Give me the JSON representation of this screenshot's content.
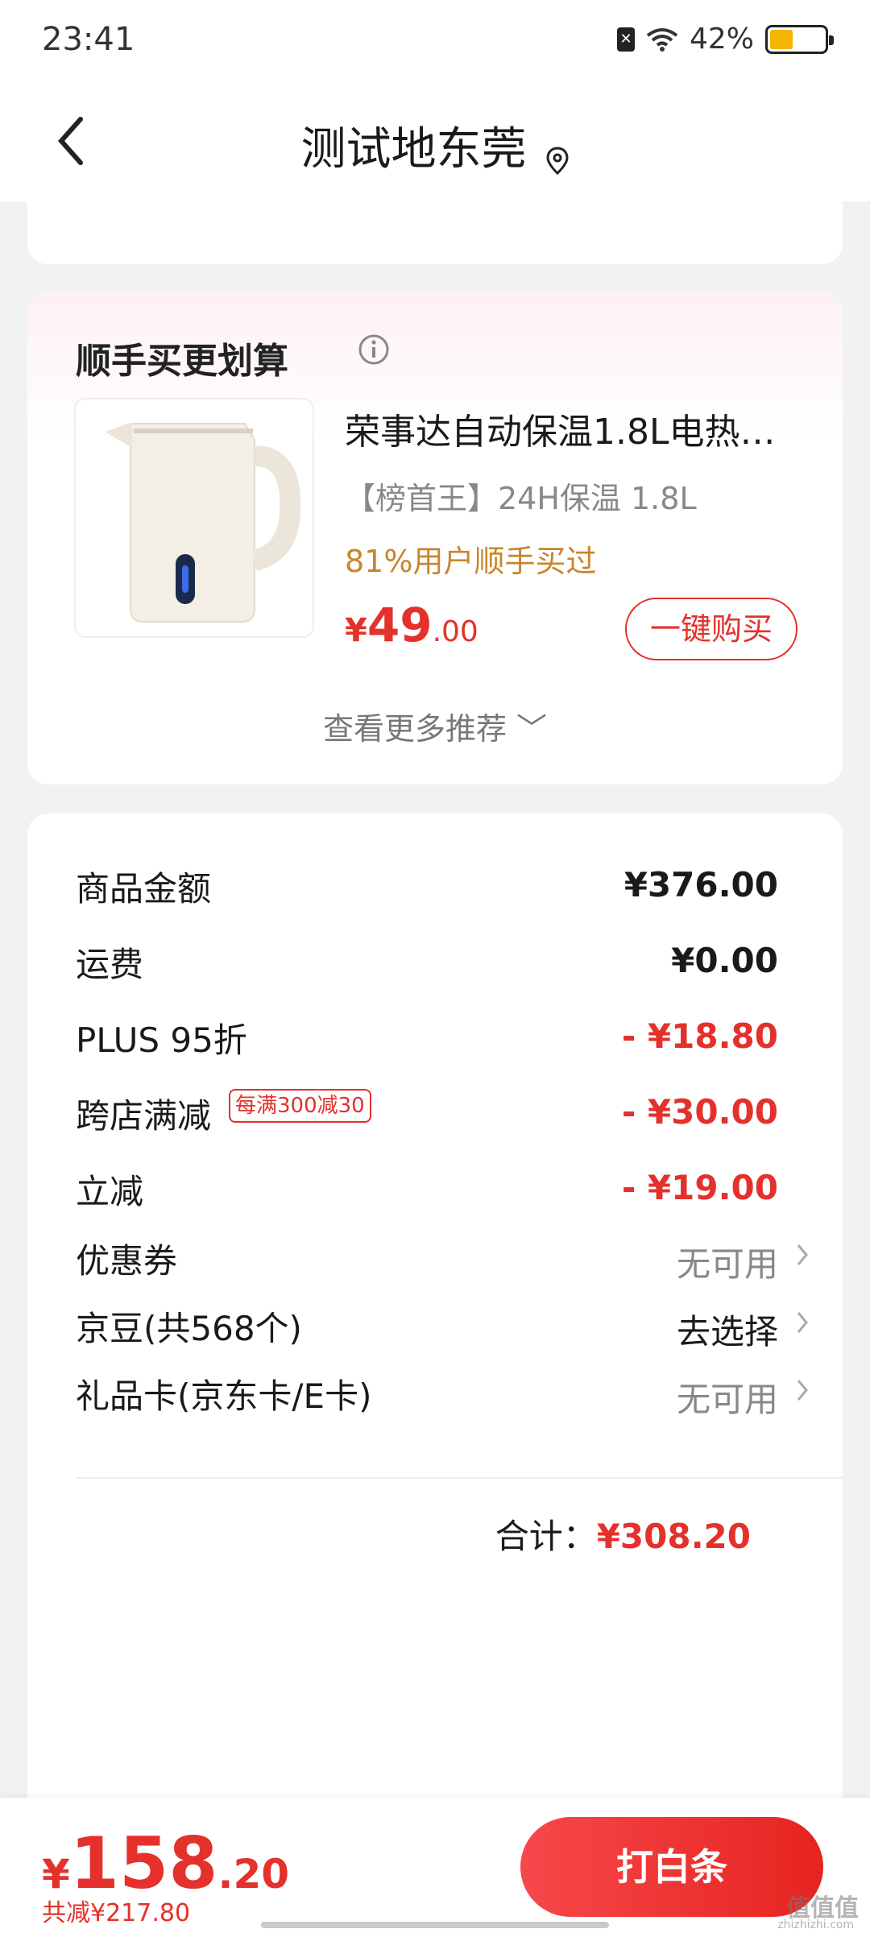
{
  "status_bar": {
    "time": "23:41",
    "battery": "42%",
    "sim_icon": "sim-x-icon",
    "wifi_icon": "wifi-icon"
  },
  "nav": {
    "title": "测试地东莞",
    "back_icon": "chevron-left-icon",
    "location_icon": "location-pin-icon"
  },
  "recommend": {
    "title": "顺手买更划算",
    "info_icon": "info-icon",
    "product": {
      "name": "荣事达自动保温1.8L电热…",
      "sub": "【榜首王】24H保温 1.8L",
      "hint": "81%用户顺手买过",
      "price_symbol": "¥",
      "price_int": "49",
      "price_dec": ".00",
      "buy_label": "一键购买"
    },
    "see_more": "查看更多推荐 ﹀"
  },
  "summary": {
    "rows": [
      {
        "label": "商品金额",
        "value": "¥376.00"
      },
      {
        "label": "运费",
        "value": "¥0.00"
      },
      {
        "label": "PLUS 95折",
        "value": "- ¥18.80"
      },
      {
        "label": "跨店满减",
        "tag": "每满300减30",
        "value": "- ¥30.00"
      },
      {
        "label": "立减",
        "value": "- ¥19.00"
      },
      {
        "label": "优惠券",
        "value": "无可用"
      },
      {
        "label": "京豆(共568个)",
        "value": "去选择"
      },
      {
        "label": "礼品卡(京东卡/E卡)",
        "value": "无可用"
      }
    ],
    "total_label": "合计：",
    "total_value": "¥308.20"
  },
  "bottom": {
    "pay_symbol": "¥",
    "pay_int": "158",
    "pay_dec": ".20",
    "saved": "共减¥217.80",
    "pay_button": "打白条",
    "watermark": "值值值",
    "watermark_sub": "zhizhizhi.com"
  },
  "colors": {
    "accent": "#e4312b",
    "hint": "#c8862c",
    "background": "#f2f2f2"
  }
}
